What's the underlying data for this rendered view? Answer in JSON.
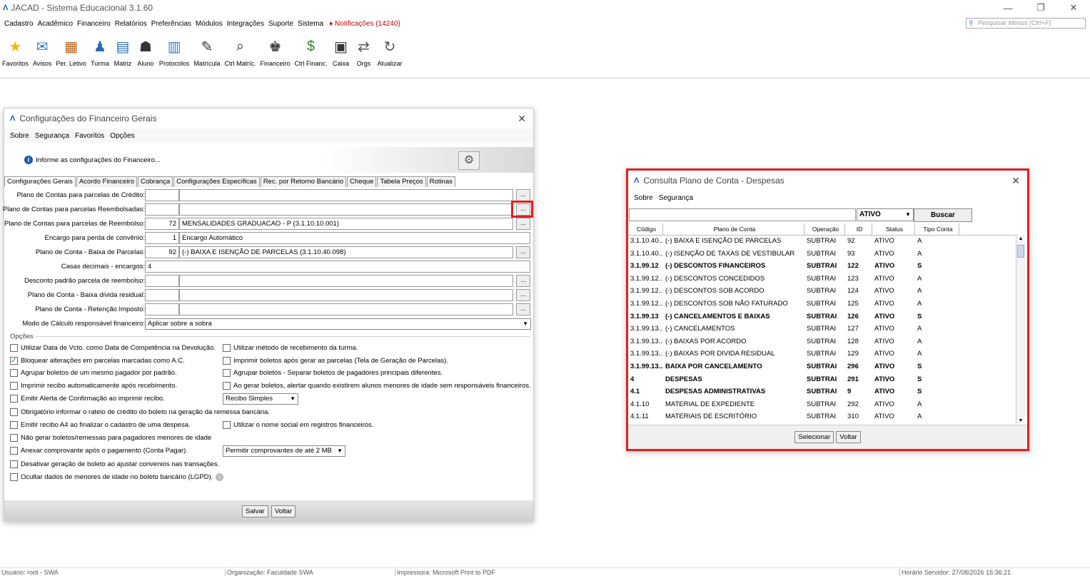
{
  "app": {
    "title": "JACAD - Sistema Educacional 3.1.60",
    "logo": "Λ"
  },
  "menu": {
    "items": [
      "Cadastro",
      "Acadêmico",
      "Financeiro",
      "Relatórios",
      "Preferências",
      "Módulos",
      "Integrações",
      "Suporte",
      "Sistema"
    ],
    "notifications": "Notificações (14240)",
    "search_placeholder": "Pesquisar Menus (Ctrl+F)"
  },
  "toolbar": {
    "items": [
      {
        "label": "Favoritos",
        "icon": "star-icon"
      },
      {
        "label": "Avisos",
        "icon": "mail-icon"
      },
      {
        "label": "Per. Letivo",
        "icon": "calendar-icon"
      },
      {
        "label": "Turma",
        "icon": "class-icon"
      },
      {
        "label": "Matriz",
        "icon": "matrix-icon"
      },
      {
        "label": "Aluno",
        "icon": "student-icon"
      },
      {
        "label": "Protocolos",
        "icon": "protocol-icon"
      },
      {
        "label": "Matrícula",
        "icon": "enroll-icon"
      },
      {
        "label": "Ctrl Matríc.",
        "icon": "search-doc-icon"
      },
      {
        "label": "Financeiro",
        "icon": "finance-icon"
      },
      {
        "label": "Ctrl Financ.",
        "icon": "money-icon"
      },
      {
        "label": "Caixa",
        "icon": "cash-register-icon"
      },
      {
        "label": "Orgs",
        "icon": "swap-icon"
      },
      {
        "label": "Atualizar",
        "icon": "refresh-icon"
      }
    ]
  },
  "config": {
    "title": "Configurações do Financeiro Gerais",
    "menu": [
      "Sobre",
      "Segurança",
      "Favoritos",
      "Opções"
    ],
    "info": "Informe as configurações do Financeiro...",
    "tabs": [
      "Configurações Gerais",
      "Acordo Financeiro",
      "Cobrança",
      "Configurações Específicas",
      "Rec. por Retorno Bancário",
      "Cheque",
      "Tabela Preços",
      "Rotinas"
    ],
    "fields": [
      {
        "label": "Plano de Contas para parcelas de Crédito:",
        "code": "",
        "value": ""
      },
      {
        "label": "Plano de Contas para parcelas Reembolsadas:",
        "code": "",
        "value": ""
      },
      {
        "label": "Plano de Contas para parcelas de Reembolso:",
        "code": "72",
        "value": "MENSALIDADES GRADUACAO - P (3.1.10.10.001)"
      },
      {
        "label": "Encargo para perda de convênio:",
        "code": "1",
        "value": "Encargo Automático"
      },
      {
        "label": "Plano de Conta - Baixa de Parcelas:",
        "code": "92",
        "value": "(-) BAIXA E ISENÇÃO DE PARCELAS (3.1.10.40.098)"
      },
      {
        "label": "Casas decimais - encargos:",
        "code": "4",
        "value": ""
      },
      {
        "label": "Desconto padrão parcela de reembolso:",
        "code": "",
        "value": ""
      },
      {
        "label": "Plano de Conta - Baixa dívida residual:",
        "code": "",
        "value": ""
      },
      {
        "label": "Plano de Conta - Retenção Imposto:",
        "code": "",
        "value": ""
      },
      {
        "label": "Modo de Cálculo responsável financeiro:",
        "code": "Aplicar sobre a sobra",
        "value": ""
      }
    ],
    "options_label": "Opções",
    "checks_left": [
      {
        "label": "Utilizar Data de Vcto. como Data de Competência na Devolução.",
        "checked": false
      },
      {
        "label": "Bloquear alterações em parcelas marcadas como A.C.",
        "checked": true
      },
      {
        "label": "Agrupar boletos de um mesmo pagador por padrão.",
        "checked": false
      },
      {
        "label": "Imprimir recibo automaticamente após recebimento.",
        "checked": false
      },
      {
        "label": "Emitir Alerta de Confirmação ao imprimir recibo.",
        "checked": false
      },
      {
        "label": "Obrigatório informar o rateio de crédito do boleto na geração da remessa bancária.",
        "checked": false
      },
      {
        "label": "Emitir recibo A4 ao finalizar o cadastro de uma despesa.",
        "checked": false
      },
      {
        "label": "Não gerar boletos/remessas para pagadores menores de idade",
        "checked": false
      },
      {
        "label": "Anexar comprovante após o pagamento (Conta Pagar).",
        "checked": false
      },
      {
        "label": "Desativar geração de boleto ao ajustar convenios nas transações.",
        "checked": false
      },
      {
        "label": "Ocultar dados de menores de idade no boleto bancário (LGPD).",
        "checked": false
      }
    ],
    "checks_right": [
      {
        "label": "Utilizar método de recebimento da turma.",
        "checked": false
      },
      {
        "label": "Imprimir boletos após gerar as parcelas (Tela de Geração de Parcelas).",
        "checked": false
      },
      {
        "label": "Agrupar boletos - Separar boletos de pagadores principais diferentes.",
        "checked": false
      },
      {
        "label": "Ao gerar boletos, alertar quando existirem alunos menores de idade sem responsáveis financeiros.",
        "checked": false
      },
      {
        "label": "Utilizar o nome social em registros financeiros.",
        "checked": false
      }
    ],
    "recibo_select": "Recibo Simples",
    "comprovante_select": "Permitir comprovantes de até 2 MB",
    "save": "Salvar",
    "back": "Voltar"
  },
  "consulta": {
    "title": "Consulta Plano de Conta - Despesas",
    "menu": [
      "Sobre",
      "Segurança"
    ],
    "status_filter": "ATIVO",
    "search_button": "Buscar",
    "columns": [
      "Código",
      "Plano de Conta",
      "Operação",
      "ID",
      "Status",
      "Tipo Conta"
    ],
    "rows": [
      {
        "codigo": "3.1.10.40....",
        "plano": "(-) BAIXA E ISENÇÃO DE PARCELAS",
        "op": "SUBTRAI",
        "id": "92",
        "status": "ATIVO",
        "tipo": "A",
        "bold": false
      },
      {
        "codigo": "3.1.10.40....",
        "plano": "(-) ISENÇÃO DE TAXAS DE VESTIBULAR",
        "op": "SUBTRAI",
        "id": "93",
        "status": "ATIVO",
        "tipo": "A",
        "bold": false
      },
      {
        "codigo": "3.1.99.12",
        "plano": "(-) DESCONTOS FINANCEIROS",
        "op": "SUBTRAI",
        "id": "122",
        "status": "ATIVO",
        "tipo": "S",
        "bold": true
      },
      {
        "codigo": "3.1.99.12....",
        "plano": "(-) DESCONTOS CONCEDIDOS",
        "op": "SUBTRAI",
        "id": "123",
        "status": "ATIVO",
        "tipo": "A",
        "bold": false
      },
      {
        "codigo": "3.1.99.12....",
        "plano": "(-) DESCONTOS SOB ACORDO",
        "op": "SUBTRAI",
        "id": "124",
        "status": "ATIVO",
        "tipo": "A",
        "bold": false
      },
      {
        "codigo": "3.1.99.12....",
        "plano": "(-) DESCONTOS SOB NÃO FATURADO",
        "op": "SUBTRAI",
        "id": "125",
        "status": "ATIVO",
        "tipo": "A",
        "bold": false
      },
      {
        "codigo": "3.1.99.13",
        "plano": "(-) CANCELAMENTOS E BAIXAS",
        "op": "SUBTRAI",
        "id": "126",
        "status": "ATIVO",
        "tipo": "S",
        "bold": true
      },
      {
        "codigo": "3.1.99.13....",
        "plano": "(-) CANCELAMENTOS",
        "op": "SUBTRAI",
        "id": "127",
        "status": "ATIVO",
        "tipo": "A",
        "bold": false
      },
      {
        "codigo": "3.1.99.13....",
        "plano": "(-) BAIXAS POR ACORDO",
        "op": "SUBTRAI",
        "id": "128",
        "status": "ATIVO",
        "tipo": "A",
        "bold": false
      },
      {
        "codigo": "3.1.99.13....",
        "plano": "(-) BAIXAS POR DIVIDA RESIDUAL",
        "op": "SUBTRAI",
        "id": "129",
        "status": "ATIVO",
        "tipo": "A",
        "bold": false
      },
      {
        "codigo": "3.1.99.13....",
        "plano": "BAIXA POR CANCELAMENTO",
        "op": "SUBTRAI",
        "id": "296",
        "status": "ATIVO",
        "tipo": "S",
        "bold": true
      },
      {
        "codigo": "4",
        "plano": "DESPESAS",
        "op": "SUBTRAI",
        "id": "291",
        "status": "ATIVO",
        "tipo": "S",
        "bold": true
      },
      {
        "codigo": "4.1",
        "plano": "DESPESAS ADMINISTRATIVAS",
        "op": "SUBTRAI",
        "id": "9",
        "status": "ATIVO",
        "tipo": "S",
        "bold": true
      },
      {
        "codigo": "4.1.10",
        "plano": "MATERIAL DE EXPEDIENTE",
        "op": "SUBTRAI",
        "id": "292",
        "status": "ATIVO",
        "tipo": "A",
        "bold": false
      },
      {
        "codigo": "4.1.11",
        "plano": "MATERIAIS DE ESCRITÓRIO",
        "op": "SUBTRAI",
        "id": "310",
        "status": "ATIVO",
        "tipo": "A",
        "bold": false
      }
    ],
    "select": "Selecionar",
    "back": "Voltar"
  },
  "status": {
    "user": "Usuário: root - SWA",
    "org": "Organização: Faculdade SWA",
    "printer": "Impressora: Microsoft Print to PDF",
    "server_time": "Horário Servidor: 27/08/2026 15:36:21"
  },
  "colors": {
    "highlight": "#e02020",
    "brand": "#1e5aa8",
    "notify": "#cc0000"
  }
}
